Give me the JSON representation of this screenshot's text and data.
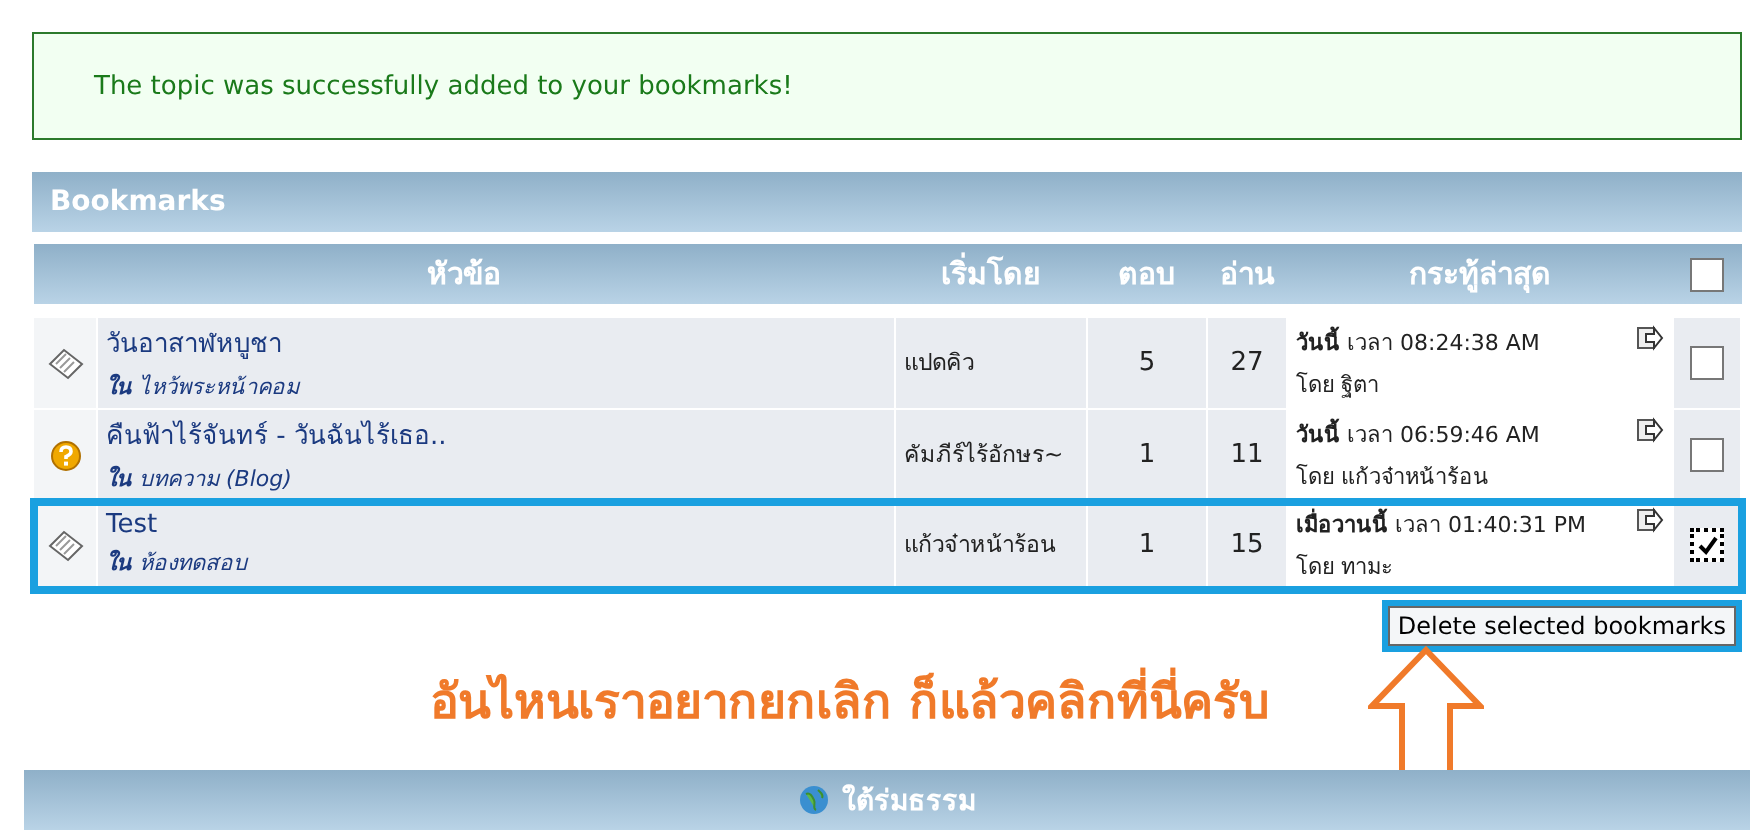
{
  "message": "The topic was successfully added to your bookmarks!",
  "panel": {
    "title": "Bookmarks"
  },
  "table": {
    "columns": [
      "หัวข้อ",
      "เริ่มโดย",
      "ตอบ",
      "อ่าน",
      "กระทู้ล่าสุด"
    ],
    "select_all": {
      "checked": false
    },
    "rows": [
      {
        "kind": "topic",
        "title": "วันอาสาฬหบูชา",
        "in_label": "ใน",
        "forum": "ไหว้พระหน้าคอม",
        "starter": "แปดคิว",
        "replies": "5",
        "views": "27",
        "last_day": "วันนี้",
        "last_time": "เวลา 08:24:38 AM",
        "by_label": "โดย",
        "last_by": "ฐิตา",
        "checked": false,
        "highlighted": false
      },
      {
        "kind": "question",
        "title": "คืนฟ้าไร้จันทร์ - วันฉันไร้เธอ..",
        "in_label": "ใน",
        "forum": "บทความ (Blog)",
        "starter": "คัมภีร์ไร้อักษร~",
        "replies": "1",
        "views": "11",
        "last_day": "วันนี้",
        "last_time": "เวลา 06:59:46 AM",
        "by_label": "โดย",
        "last_by": "แก้วจ๋าหน้าร้อน",
        "checked": false,
        "highlighted": false
      },
      {
        "kind": "topic",
        "title": "Test",
        "in_label": "ใน",
        "forum": "ห้องทดสอบ",
        "starter": "แก้วจ๋าหน้าร้อน",
        "replies": "1",
        "views": "15",
        "last_day": "เมื่อวานนี้",
        "last_time": "เวลา 01:40:31 PM",
        "by_label": "โดย",
        "last_by": "ทามะ",
        "checked": true,
        "highlighted": true
      }
    ]
  },
  "delete_button": "Delete selected bookmarks",
  "annotation": "อันไหนเราอยากยกเลิก ก็แล้วคลิกที่นี่ครับ",
  "footer": "ใต้ร่มธรรม"
}
